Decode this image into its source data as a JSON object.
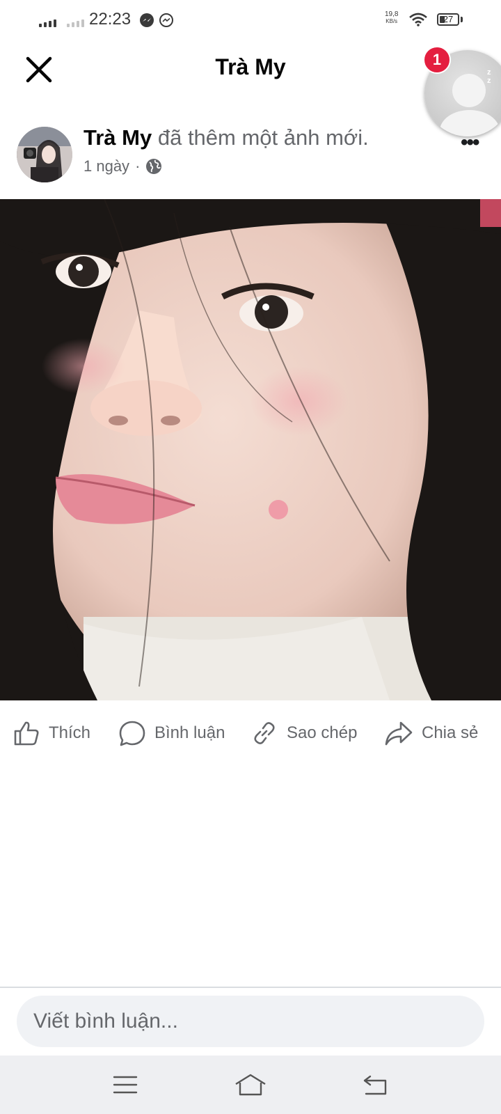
{
  "status_bar": {
    "time": "22:23",
    "network_speed_value": "19,8",
    "network_speed_unit": "KB/s",
    "battery_level": "27",
    "icons": [
      "signal-icon",
      "signal-icon-sim2",
      "messenger-icon",
      "messenger-outline-icon",
      "wifi-icon",
      "battery-icon"
    ]
  },
  "header": {
    "title": "Trà My",
    "close_icon": "close-icon"
  },
  "chat_head": {
    "badge_count": "1"
  },
  "post": {
    "author": "Trà My",
    "action_text": "đã thêm một ảnh mới.",
    "time": "1 ngày",
    "separator": "·",
    "privacy_icon": "globe-icon",
    "more_label": "•••"
  },
  "actions": [
    {
      "label": "Thích",
      "icon": "like-icon"
    },
    {
      "label": "Bình luận",
      "icon": "comment-icon"
    },
    {
      "label": "Sao chép",
      "icon": "link-icon"
    },
    {
      "label": "Chia sẻ",
      "icon": "share-icon"
    }
  ],
  "comment": {
    "placeholder": "Viết bình luận..."
  },
  "nav": {
    "icons": [
      "menu-icon",
      "home-icon",
      "back-icon"
    ]
  },
  "colors": {
    "badge": "#e41e3f",
    "secondary_text": "#65676b",
    "input_bg": "#f0f2f5",
    "nav_bg": "#eeeff2"
  }
}
